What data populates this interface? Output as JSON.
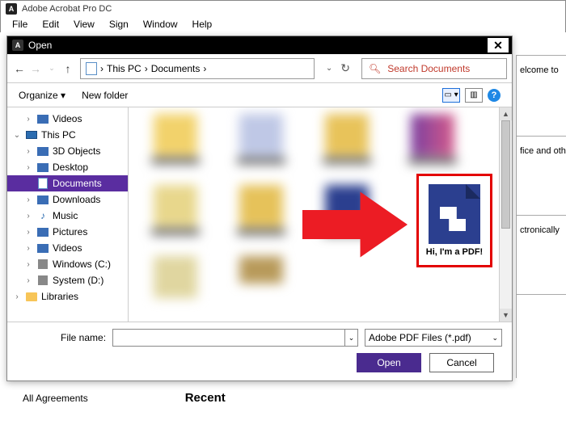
{
  "app": {
    "title": "Adobe Acrobat Pro DC"
  },
  "menu": [
    "File",
    "Edit",
    "View",
    "Sign",
    "Window",
    "Help"
  ],
  "dialog": {
    "title": "Open",
    "breadcrumb": [
      "›",
      "This PC",
      "›",
      "Documents",
      "›"
    ],
    "search_placeholder": "Search Documents",
    "organize": "Organize",
    "new_folder": "New folder",
    "tree": [
      {
        "label": "Videos",
        "icon": "blue",
        "expand": "›",
        "level": 2
      },
      {
        "label": "This PC",
        "icon": "monitor",
        "expand": "⌄",
        "level": 1
      },
      {
        "label": "3D Objects",
        "icon": "blue",
        "expand": "›",
        "level": 2
      },
      {
        "label": "Desktop",
        "icon": "blue",
        "expand": "›",
        "level": 2
      },
      {
        "label": "Documents",
        "icon": "doc",
        "expand": "",
        "level": 2,
        "selected": true
      },
      {
        "label": "Downloads",
        "icon": "blue",
        "expand": "›",
        "level": 2
      },
      {
        "label": "Music",
        "icon": "music",
        "expand": "›",
        "level": 2
      },
      {
        "label": "Pictures",
        "icon": "blue",
        "expand": "›",
        "level": 2
      },
      {
        "label": "Videos",
        "icon": "blue",
        "expand": "›",
        "level": 2
      },
      {
        "label": "Windows (C:)",
        "icon": "gray",
        "expand": "›",
        "level": 2
      },
      {
        "label": "System (D:)",
        "icon": "gray",
        "expand": "›",
        "level": 2
      },
      {
        "label": "Libraries",
        "icon": "folder",
        "expand": "›",
        "level": 1
      }
    ],
    "highlight_file": "Hi, I'm a PDF!",
    "file_name_label": "File name:",
    "file_type": "Adobe PDF Files (*.pdf)",
    "open_btn": "Open",
    "cancel_btn": "Cancel"
  },
  "right_panel": [
    "elcome to",
    "fice and other",
    "ctronically"
  ],
  "below": {
    "all": "All Agreements",
    "recent": "Recent"
  }
}
